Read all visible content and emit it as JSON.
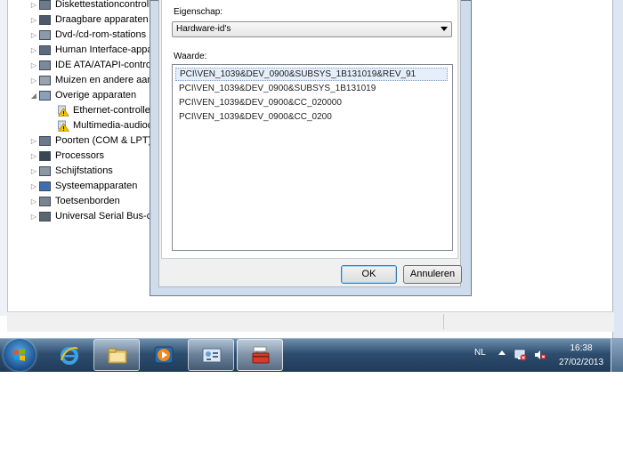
{
  "device_manager": {
    "tree": [
      {
        "label": "Diskettestationcontroll",
        "icon": "floppy-controller-icon",
        "expanded": false
      },
      {
        "label": "Draagbare apparaten",
        "icon": "portable-device-icon",
        "expanded": false
      },
      {
        "label": "Dvd-/cd-rom-stations",
        "icon": "dvd-drive-icon",
        "expanded": false
      },
      {
        "label": "Human Interface-appa",
        "icon": "hid-icon",
        "expanded": false
      },
      {
        "label": "IDE ATA/ATAPI-contro",
        "icon": "ide-controller-icon",
        "expanded": false
      },
      {
        "label": "Muizen en andere aanv",
        "icon": "mouse-icon",
        "expanded": false
      },
      {
        "label": "Overige apparaten",
        "icon": "other-devices-icon",
        "expanded": true
      },
      {
        "label": "Ethernet-controller",
        "icon": "warning-icon",
        "child": true
      },
      {
        "label": "Multimedia-audioc",
        "icon": "warning-icon",
        "child": true
      },
      {
        "label": "Poorten (COM & LPT)",
        "icon": "port-icon",
        "expanded": false
      },
      {
        "label": "Processors",
        "icon": "processor-icon",
        "expanded": false
      },
      {
        "label": "Schijfstations",
        "icon": "disk-drive-icon",
        "expanded": false
      },
      {
        "label": "Systeemapparaten",
        "icon": "system-device-icon",
        "expanded": false
      },
      {
        "label": "Toetsenborden",
        "icon": "keyboard-icon",
        "expanded": false
      },
      {
        "label": "Universal Serial Bus-co",
        "icon": "usb-icon",
        "expanded": false
      }
    ]
  },
  "dialog": {
    "property_label": "Eigenschap:",
    "property_value": "Hardware-id's",
    "value_label": "Waarde:",
    "values": [
      "PCI\\VEN_1039&DEV_0900&SUBSYS_1B131019&REV_91",
      "PCI\\VEN_1039&DEV_0900&SUBSYS_1B131019",
      "PCI\\VEN_1039&DEV_0900&CC_020000",
      "PCI\\VEN_1039&DEV_0900&CC_0200"
    ],
    "selected_index": 0,
    "ok_label": "OK",
    "cancel_label": "Annuleren"
  },
  "taskbar": {
    "pinned": [
      "internet-explorer-icon",
      "explorer-folder-icon",
      "media-player-icon",
      "device-manager-icon",
      "toolbox-icon"
    ],
    "language": "NL",
    "time": "16:38",
    "date": "27/02/2013"
  },
  "colors": {
    "taskbar": "#2e4d6e",
    "selection": "#e5eef9",
    "warning": "#f2c200"
  }
}
